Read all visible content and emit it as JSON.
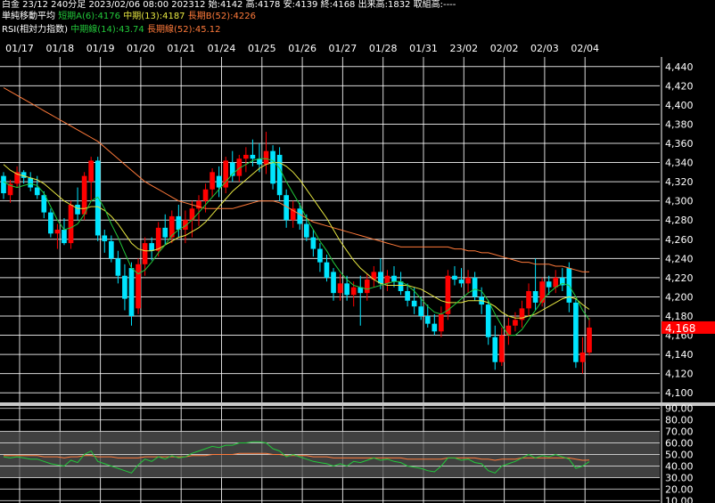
{
  "header": {
    "line1": "白金 23/12 240分足 2023/02/06 08:00 202312 始:4142 高:4178 安:4139 終:4168 出来高:1832 取組高:----",
    "line2_title": "単純移動平均",
    "line2_short": "短期A(6):4176",
    "line2_mid": "中期(13):4187",
    "line2_long": "長期B(52):4226",
    "line3_title": "RSI(相対力指数)",
    "line3_mid": "中期線(14):43.74",
    "line3_long": "長期線(52):45.12"
  },
  "colors": {
    "up": "#ff0000",
    "down": "#00e5ff",
    "ma_short": "#22c83a",
    "ma_mid": "#e6e640",
    "ma_long": "#ff7a3a",
    "rsi_mid": "#22c83a",
    "rsi_long": "#ff7a3a",
    "price_tag": "#ff0000"
  },
  "chart_data": [
    {
      "type": "candlestick",
      "x_labels": [
        "01/17",
        "01/18",
        "01/19",
        "01/20",
        "01/21",
        "01/24",
        "01/25",
        "01/26",
        "01/27",
        "01/28",
        "01/31",
        "23/02",
        "02/02",
        "02/03",
        "02/04"
      ],
      "y_ticks": [
        "4,440",
        "4,420",
        "4,400",
        "4,380",
        "4,360",
        "4,340",
        "4,320",
        "4,300",
        "4,280",
        "4,260",
        "4,240",
        "4,220",
        "4,200",
        "4,180",
        "4,160",
        "4,140",
        "4,120",
        "4,100"
      ],
      "ylim": [
        4090,
        4450
      ],
      "last_price_label": "4,168",
      "candles": [
        [
          4326,
          4330,
          4302,
          4308
        ],
        [
          4306,
          4322,
          4298,
          4318
        ],
        [
          4318,
          4336,
          4314,
          4330
        ],
        [
          4330,
          4332,
          4318,
          4324
        ],
        [
          4324,
          4330,
          4310,
          4314
        ],
        [
          4314,
          4326,
          4302,
          4306
        ],
        [
          4306,
          4310,
          4282,
          4288
        ],
        [
          4288,
          4292,
          4262,
          4266
        ],
        [
          4266,
          4276,
          4250,
          4270
        ],
        [
          4270,
          4282,
          4254,
          4256
        ],
        [
          4256,
          4300,
          4250,
          4296
        ],
        [
          4296,
          4314,
          4280,
          4286
        ],
        [
          4286,
          4330,
          4280,
          4326
        ],
        [
          4320,
          4346,
          4300,
          4342
        ],
        [
          4342,
          4346,
          4258,
          4264
        ],
        [
          4264,
          4270,
          4246,
          4258
        ],
        [
          4258,
          4264,
          4236,
          4240
        ],
        [
          4240,
          4248,
          4214,
          4222
        ],
        [
          4222,
          4234,
          4186,
          4198
        ],
        [
          4230,
          4236,
          4170,
          4180
        ],
        [
          4188,
          4240,
          4182,
          4234
        ],
        [
          4234,
          4262,
          4222,
          4256
        ],
        [
          4256,
          4262,
          4238,
          4248
        ],
        [
          4248,
          4278,
          4242,
          4272
        ],
        [
          4272,
          4286,
          4254,
          4262
        ],
        [
          4262,
          4290,
          4256,
          4284
        ],
        [
          4284,
          4296,
          4262,
          4270
        ],
        [
          4270,
          4290,
          4256,
          4280
        ],
        [
          4280,
          4300,
          4262,
          4292
        ],
        [
          4292,
          4306,
          4274,
          4300
        ],
        [
          4300,
          4318,
          4288,
          4312
        ],
        [
          4312,
          4334,
          4304,
          4330
        ],
        [
          4326,
          4336,
          4304,
          4314
        ],
        [
          4314,
          4346,
          4308,
          4342
        ],
        [
          4340,
          4352,
          4320,
          4326
        ],
        [
          4326,
          4348,
          4320,
          4344
        ],
        [
          4344,
          4356,
          4330,
          4348
        ],
        [
          4348,
          4364,
          4336,
          4344
        ],
        [
          4344,
          4360,
          4330,
          4338
        ],
        [
          4338,
          4372,
          4328,
          4352
        ],
        [
          4352,
          4358,
          4312,
          4318
        ],
        [
          4348,
          4356,
          4300,
          4306
        ],
        [
          4306,
          4312,
          4272,
          4280
        ],
        [
          4280,
          4300,
          4272,
          4292
        ],
        [
          4292,
          4298,
          4270,
          4276
        ],
        [
          4276,
          4286,
          4258,
          4262
        ],
        [
          4262,
          4270,
          4242,
          4250
        ],
        [
          4250,
          4256,
          4226,
          4236
        ],
        [
          4236,
          4244,
          4216,
          4220
        ],
        [
          4226,
          4230,
          4196,
          4204
        ],
        [
          4204,
          4224,
          4196,
          4214
        ],
        [
          4214,
          4222,
          4196,
          4202
        ],
        [
          4202,
          4216,
          4190,
          4210
        ],
        [
          4210,
          4222,
          4170,
          4204
        ],
        [
          4204,
          4224,
          4196,
          4218
        ],
        [
          4218,
          4232,
          4210,
          4226
        ],
        [
          4226,
          4240,
          4208,
          4214
        ],
        [
          4214,
          4228,
          4206,
          4222
        ],
        [
          4222,
          4232,
          4210,
          4216
        ],
        [
          4216,
          4226,
          4202,
          4206
        ],
        [
          4206,
          4214,
          4190,
          4196
        ],
        [
          4196,
          4210,
          4182,
          4190
        ],
        [
          4190,
          4200,
          4176,
          4180
        ],
        [
          4180,
          4192,
          4168,
          4172
        ],
        [
          4172,
          4182,
          4160,
          4164
        ],
        [
          4164,
          4190,
          4158,
          4182
        ],
        [
          4182,
          4228,
          4176,
          4222
        ],
        [
          4222,
          4232,
          4212,
          4218
        ],
        [
          4218,
          4230,
          4210,
          4214
        ],
        [
          4214,
          4228,
          4204,
          4220
        ],
        [
          4220,
          4226,
          4196,
          4200
        ],
        [
          4200,
          4210,
          4182,
          4192
        ],
        [
          4192,
          4196,
          4150,
          4158
        ],
        [
          4158,
          4170,
          4124,
          4132
        ],
        [
          4132,
          4168,
          4128,
          4160
        ],
        [
          4160,
          4178,
          4150,
          4170
        ],
        [
          4170,
          4184,
          4164,
          4176
        ],
        [
          4176,
          4196,
          4168,
          4188
        ],
        [
          4188,
          4214,
          4180,
          4206
        ],
        [
          4206,
          4240,
          4186,
          4194
        ],
        [
          4194,
          4220,
          4190,
          4216
        ],
        [
          4216,
          4222,
          4202,
          4210
        ],
        [
          4210,
          4228,
          4204,
          4220
        ],
        [
          4220,
          4230,
          4206,
          4212
        ],
        [
          4230,
          4236,
          4184,
          4194
        ],
        [
          4194,
          4198,
          4126,
          4132
        ],
        [
          4132,
          4158,
          4120,
          4142
        ],
        [
          4142,
          4178,
          4139,
          4168
        ]
      ],
      "ma_short": [
        4320,
        4316,
        4314,
        4316,
        4318,
        4316,
        4308,
        4294,
        4280,
        4270,
        4272,
        4276,
        4286,
        4300,
        4304,
        4292,
        4276,
        4262,
        4246,
        4230,
        4224,
        4228,
        4236,
        4246,
        4254,
        4264,
        4270,
        4274,
        4280,
        4288,
        4296,
        4304,
        4312,
        4320,
        4328,
        4334,
        4338,
        4342,
        4344,
        4344,
        4342,
        4334,
        4320,
        4308,
        4296,
        4282,
        4270,
        4258,
        4248,
        4236,
        4226,
        4218,
        4212,
        4210,
        4208,
        4210,
        4212,
        4214,
        4216,
        4216,
        4212,
        4206,
        4198,
        4190,
        4184,
        4182,
        4186,
        4192,
        4198,
        4204,
        4208,
        4206,
        4196,
        4182,
        4170,
        4160,
        4160,
        4166,
        4176,
        4186,
        4196,
        4204,
        4210,
        4214,
        4212,
        4200,
        4186,
        4176
      ],
      "ma_mid": [
        4338,
        4332,
        4328,
        4326,
        4324,
        4322,
        4318,
        4312,
        4306,
        4300,
        4296,
        4292,
        4292,
        4294,
        4294,
        4290,
        4284,
        4276,
        4266,
        4256,
        4250,
        4248,
        4248,
        4250,
        4254,
        4258,
        4262,
        4264,
        4268,
        4272,
        4278,
        4286,
        4294,
        4302,
        4310,
        4316,
        4322,
        4328,
        4334,
        4338,
        4340,
        4340,
        4336,
        4330,
        4322,
        4312,
        4302,
        4292,
        4282,
        4270,
        4258,
        4248,
        4238,
        4230,
        4224,
        4218,
        4214,
        4212,
        4212,
        4212,
        4212,
        4210,
        4208,
        4204,
        4200,
        4196,
        4194,
        4194,
        4194,
        4196,
        4196,
        4196,
        4194,
        4190,
        4184,
        4180,
        4178,
        4178,
        4180,
        4182,
        4186,
        4190,
        4194,
        4198,
        4200,
        4198,
        4192,
        4187
      ],
      "ma_long": [
        4418,
        4414,
        4410,
        4406,
        4402,
        4398,
        4394,
        4390,
        4386,
        4382,
        4378,
        4374,
        4370,
        4366,
        4362,
        4356,
        4350,
        4344,
        4338,
        4332,
        4326,
        4320,
        4316,
        4312,
        4308,
        4304,
        4300,
        4298,
        4296,
        4294,
        4292,
        4292,
        4292,
        4292,
        4292,
        4294,
        4296,
        4298,
        4300,
        4300,
        4300,
        4298,
        4294,
        4290,
        4286,
        4282,
        4278,
        4276,
        4274,
        4272,
        4270,
        4268,
        4266,
        4264,
        4262,
        4260,
        4258,
        4256,
        4254,
        4252,
        4252,
        4252,
        4252,
        4252,
        4252,
        4252,
        4252,
        4250,
        4250,
        4248,
        4248,
        4246,
        4246,
        4244,
        4242,
        4240,
        4238,
        4236,
        4236,
        4234,
        4234,
        4234,
        4232,
        4232,
        4230,
        4228,
        4226,
        4226
      ]
    },
    {
      "type": "line",
      "name": "RSI",
      "y_ticks": [
        "90.00",
        "80.00",
        "70.00",
        "60.00",
        "50.00",
        "40.00",
        "30.00",
        "20.00",
        "10.00"
      ],
      "ylim": [
        8,
        92
      ],
      "bands": [
        [
          30,
          70
        ]
      ],
      "rsi_mid": [
        48,
        47,
        48,
        47,
        46,
        46,
        44,
        42,
        41,
        40,
        45,
        43,
        50,
        53,
        44,
        42,
        40,
        38,
        36,
        34,
        41,
        46,
        44,
        48,
        46,
        49,
        47,
        48,
        51,
        53,
        55,
        57,
        56,
        58,
        58,
        60,
        60,
        61,
        61,
        60,
        55,
        53,
        48,
        50,
        48,
        46,
        44,
        43,
        42,
        40,
        42,
        40,
        44,
        43,
        45,
        47,
        45,
        46,
        44,
        43,
        40,
        39,
        38,
        36,
        35,
        40,
        47,
        47,
        45,
        46,
        43,
        42,
        36,
        34,
        40,
        42,
        44,
        47,
        50,
        47,
        49,
        48,
        50,
        48,
        46,
        38,
        40,
        43.74
      ],
      "rsi_long": [
        49,
        49,
        49,
        49,
        49,
        49,
        48,
        48,
        48,
        47,
        48,
        48,
        49,
        49,
        48,
        48,
        48,
        47,
        47,
        47,
        47,
        48,
        48,
        48,
        48,
        48,
        48,
        48,
        49,
        49,
        49,
        50,
        50,
        50,
        50,
        51,
        51,
        51,
        51,
        51,
        50,
        50,
        49,
        49,
        49,
        49,
        48,
        48,
        48,
        47,
        47,
        47,
        47,
        47,
        47,
        47,
        47,
        47,
        47,
        47,
        46,
        46,
        46,
        46,
        46,
        46,
        47,
        47,
        47,
        47,
        47,
        46,
        46,
        45,
        46,
        46,
        46,
        47,
        47,
        47,
        47,
        47,
        47,
        47,
        47,
        46,
        45,
        45.12
      ]
    }
  ]
}
